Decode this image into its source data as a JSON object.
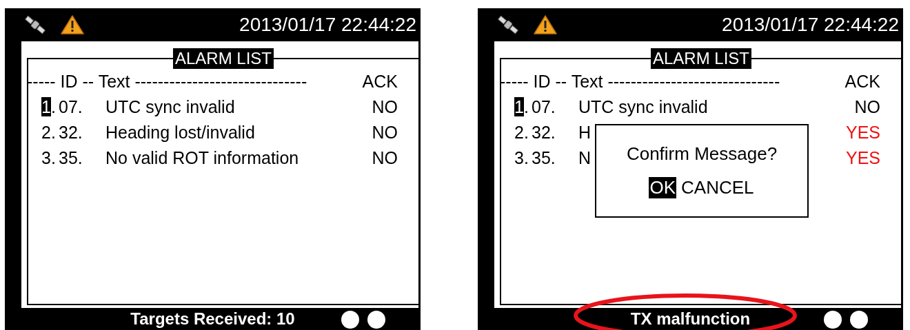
{
  "screens": [
    {
      "datetime": "2013/01/17 22:44:22",
      "title": "ALARM LIST",
      "header": {
        "text": "----- ID -- Text ------------------------------",
        "ack": "ACK"
      },
      "rows": [
        {
          "index": "1.",
          "id": "07.",
          "text": "UTC sync invalid",
          "ack": "NO",
          "acknowledged": false,
          "selected": true
        },
        {
          "index": "2.",
          "id": "32.",
          "text": "Heading lost/invalid",
          "ack": "NO",
          "acknowledged": false,
          "selected": false
        },
        {
          "index": "3.",
          "id": "35.",
          "text": "No valid ROT information",
          "ack": "NO",
          "acknowledged": false,
          "selected": false
        }
      ],
      "status": {
        "text": "Targets Received: 10"
      }
    },
    {
      "datetime": "2013/01/17 22:44:22",
      "title": "ALARM LIST",
      "header": {
        "text": "----- ID -- Text ------------------------------",
        "ack": "ACK"
      },
      "rows": [
        {
          "index": "1.",
          "id": "07.",
          "text": "UTC sync invalid",
          "ack": "NO",
          "acknowledged": false,
          "selected": true
        },
        {
          "index": "2.",
          "id": "32.",
          "text": "H",
          "ack": "YES",
          "acknowledged": true,
          "selected": false
        },
        {
          "index": "3.",
          "id": "35.",
          "text": "N",
          "ack": "YES",
          "acknowledged": true,
          "selected": false
        }
      ],
      "dialog": {
        "message": "Confirm Message?",
        "buttons": [
          {
            "label": "OK",
            "selected": true
          },
          {
            "label": "CANCEL",
            "selected": false
          }
        ]
      },
      "status": {
        "text": "TX malfunction",
        "highlighted": true
      }
    }
  ]
}
